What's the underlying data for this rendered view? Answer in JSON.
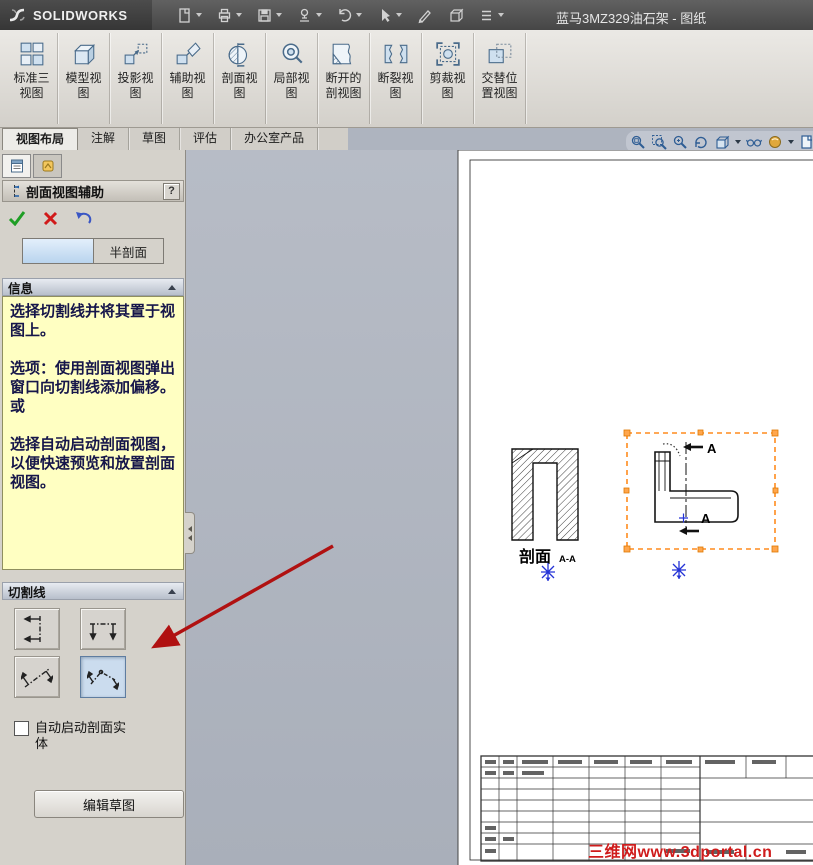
{
  "titlebar": {
    "logo_text": "SOLIDWORKS",
    "title": "蓝马3MZ329油石架 - 图纸"
  },
  "ribbon": {
    "buttons": [
      {
        "line1": "标准三",
        "line2": "视图"
      },
      {
        "line1": "模型视",
        "line2": "图"
      },
      {
        "line1": "投影视",
        "line2": "图"
      },
      {
        "line1": "辅助视",
        "line2": "图"
      },
      {
        "line1": "剖面视",
        "line2": "图"
      },
      {
        "line1": "局部视",
        "line2": "图"
      },
      {
        "line1": "断开的",
        "line2": "剖视图"
      },
      {
        "line1": "断裂视",
        "line2": "图"
      },
      {
        "line1": "剪裁视",
        "line2": "图"
      },
      {
        "line1": "交替位",
        "line2": "置视图"
      }
    ]
  },
  "tabs": {
    "items": [
      {
        "label": "视图布局"
      },
      {
        "label": "注解"
      },
      {
        "label": "草图"
      },
      {
        "label": "评估"
      },
      {
        "label": "办公室产品"
      }
    ]
  },
  "panel": {
    "header": {
      "title": "剖面视图辅助",
      "help": "?"
    },
    "type_tabs": {
      "half_section": "半剖面"
    },
    "info": {
      "header": "信息",
      "p1": "选择切割线并将其置于视图上。",
      "p2": "选项：使用剖面视图弹出窗口向切割线添加偏移。",
      "p3": "或",
      "p4": "选择自动启动剖面视图，以便快速预览和放置剖面视图。"
    },
    "cutting_line": {
      "header": "切割线"
    },
    "auto_start_label": "自动启动剖面实体",
    "edit_sketch": "编辑草图"
  },
  "drawing": {
    "section_label": "剖面",
    "section_scale": "A-A",
    "letter_top": "A",
    "letter_bottom": "A",
    "watermark": "三维网www.3dportal.cn"
  },
  "colors": {
    "selection_orange": "#ff8c1e",
    "sketch_blue": "#2433d6",
    "annotation_red": "#b01111",
    "message_yellow": "#ffffc2"
  }
}
